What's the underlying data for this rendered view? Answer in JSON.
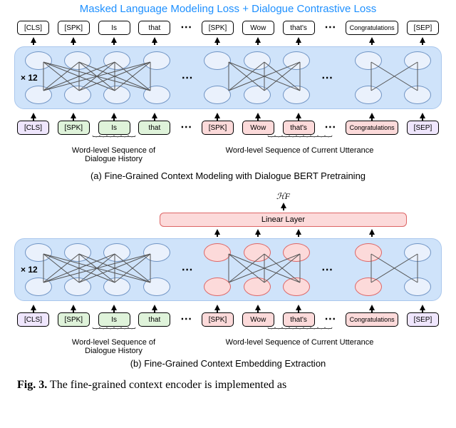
{
  "loss": {
    "title": "Masked Language Modeling Loss   +  Dialogue Contrastive Loss"
  },
  "tokens": {
    "cls": "[CLS]",
    "spk": "[SPK]",
    "is": "Is",
    "that": "that",
    "wow": "Wow",
    "thats": "that's",
    "congrats": "Congratulations",
    "sep": "[SEP]",
    "dots": "⋯"
  },
  "labels": {
    "x12": "× 12",
    "hist": "Word-level Sequence of Dialogue History",
    "curr": "Word-level Sequence of Current Utterance",
    "linear": "Linear Layer",
    "hf": "ℋF"
  },
  "captions": {
    "a": "(a) Fine-Grained Context Modeling with Dialogue BERT Pretraining",
    "b": "(b) Fine-Grained Context Embedding Extraction",
    "fig_bold": "Fig. 3.",
    "fig_rest": "  The fine-grained context encoder is implemented as"
  },
  "chart_data": {
    "type": "diagram",
    "description": "Two stacked sub-figures illustrating a BERT-style dialogue encoder. Sub (a): a 12-layer transformer (rounded blue box, ×12 on left) takes an input token sequence and emits the same sequence at top; training objective is MLM + Dialogue Contrastive Loss. Sub (b): same encoder but only the hidden states of the current-utterance span (rendered as pink ovals) are fed through a Linear Layer to produce embedding H_F.",
    "input_sequence": [
      "[CLS]",
      "[SPK]",
      "Is",
      "that",
      "…",
      "[SPK]",
      "Wow",
      "that's",
      "…",
      "Congratulations",
      "[SEP]"
    ],
    "token_colors": [
      "purple",
      "green",
      "green",
      "green",
      "",
      "pink",
      "pink",
      "pink",
      "",
      "pink",
      "purple"
    ],
    "output_sequence_a": [
      "[CLS]",
      "[SPK]",
      "Is",
      "that",
      "…",
      "[SPK]",
      "Wow",
      "that's",
      "…",
      "Congratulations",
      "[SEP]"
    ],
    "pink_span_in_b": [
      "[SPK]",
      "Wow",
      "that's",
      "…",
      "Congratulations"
    ],
    "layers": 12,
    "heads_drawn_per_group": "fully-connected bipartite within each visible 3- or 4-token group",
    "loss_terms": [
      "Masked Language Modeling Loss",
      "Dialogue Contrastive Loss"
    ],
    "output_b": "H_F via Linear Layer over current-utterance hidden states"
  }
}
